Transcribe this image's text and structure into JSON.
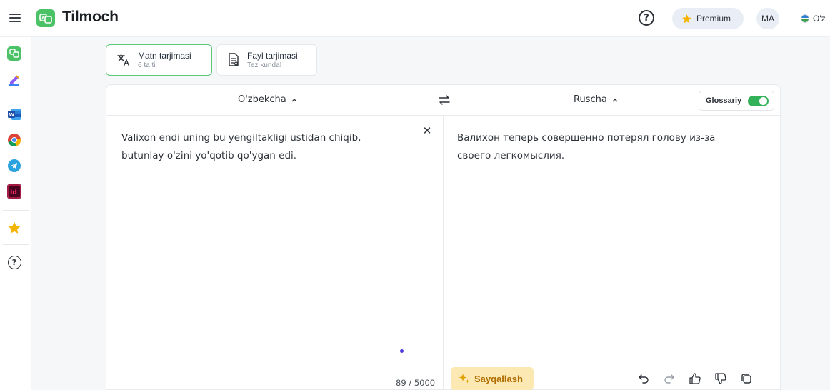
{
  "app": {
    "brand": "Tilmoch",
    "brand_color": "#4cc267",
    "accent_color": "#33b158"
  },
  "header": {
    "premium_label": "Premium",
    "avatar_initials": "MA",
    "ui_language": "O'z"
  },
  "sidebar": {
    "items": [
      {
        "name": "tilmoch-app-icon"
      },
      {
        "name": "edit-pen-icon"
      },
      {
        "name": "word-icon"
      },
      {
        "name": "chrome-icon"
      },
      {
        "name": "telegram-icon"
      },
      {
        "name": "indesign-icon",
        "label": "Id"
      },
      {
        "name": "favorites-star-icon"
      },
      {
        "name": "help-icon"
      }
    ]
  },
  "modes": [
    {
      "title": "Matn tarjimasi",
      "subtitle": "6 ta til",
      "active": true
    },
    {
      "title": "Fayl tarjimasi",
      "subtitle": "Tez kunda!",
      "active": false
    }
  ],
  "translator": {
    "source_language": "O'zbekcha",
    "target_language": "Ruscha",
    "glossary_label": "Glossariy",
    "glossary_enabled": true,
    "source_text": "Valixon endi uning bu yengiltakligi ustidan chiqib, butunlay o'zini yo'qotib qo'ygan edi.",
    "target_text": "Валихон теперь совершенно потерял голову из-за своего легкомыслия.",
    "char_count": "89 / 5000",
    "polish_label": "Sayqallash"
  }
}
